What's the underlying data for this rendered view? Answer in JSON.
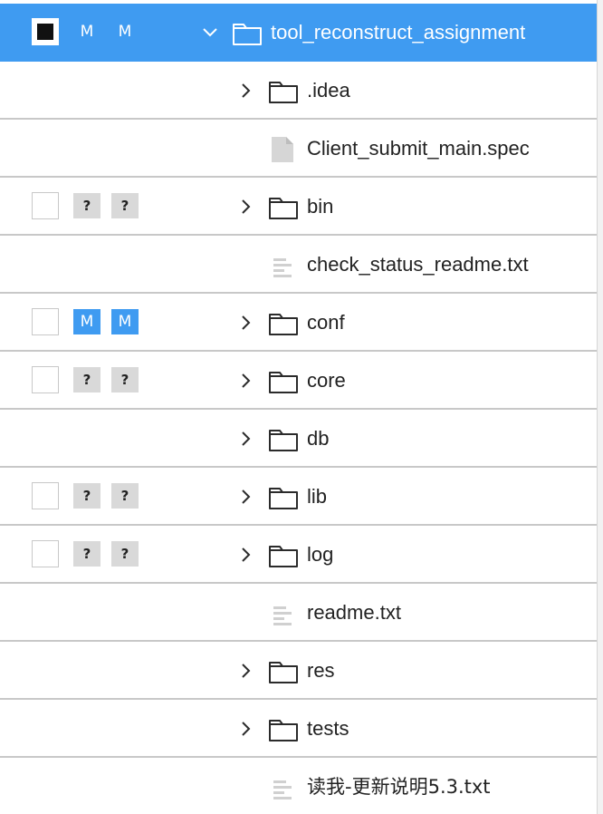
{
  "tree": {
    "items": [
      {
        "name": "tool_reconstruct_assignment",
        "type": "folder",
        "expanded": true,
        "selected": true,
        "checked": true,
        "status": [
          "M",
          "M"
        ]
      },
      {
        "name": ".idea",
        "type": "folder",
        "expanded": false,
        "selected": false,
        "checked": null,
        "status": []
      },
      {
        "name": "Client_submit_main.spec",
        "type": "file-generic",
        "selected": false,
        "checked": null,
        "status": []
      },
      {
        "name": "bin",
        "type": "folder",
        "expanded": false,
        "selected": false,
        "checked": false,
        "status": [
          "?",
          "?"
        ]
      },
      {
        "name": "check_status_readme.txt",
        "type": "file-text",
        "selected": false,
        "checked": null,
        "status": []
      },
      {
        "name": "conf",
        "type": "folder",
        "expanded": false,
        "selected": false,
        "checked": false,
        "status": [
          "M",
          "M"
        ]
      },
      {
        "name": "core",
        "type": "folder",
        "expanded": false,
        "selected": false,
        "checked": false,
        "status": [
          "?",
          "?"
        ]
      },
      {
        "name": "db",
        "type": "folder",
        "expanded": false,
        "selected": false,
        "checked": null,
        "status": []
      },
      {
        "name": "lib",
        "type": "folder",
        "expanded": false,
        "selected": false,
        "checked": false,
        "status": [
          "?",
          "?"
        ]
      },
      {
        "name": "log",
        "type": "folder",
        "expanded": false,
        "selected": false,
        "checked": false,
        "status": [
          "?",
          "?"
        ]
      },
      {
        "name": "readme.txt",
        "type": "file-text",
        "selected": false,
        "checked": null,
        "status": []
      },
      {
        "name": "res",
        "type": "folder",
        "expanded": false,
        "selected": false,
        "checked": null,
        "status": []
      },
      {
        "name": "tests",
        "type": "folder",
        "expanded": false,
        "selected": false,
        "checked": null,
        "status": []
      },
      {
        "name": "读我-更新说明5.3.txt",
        "type": "file-text",
        "selected": false,
        "checked": null,
        "status": []
      }
    ]
  },
  "colors": {
    "selection": "#3f9bf1",
    "modified_badge": "#3f9bf1",
    "unknown_badge": "#d9d9d9",
    "row_divider": "#c8c8c8",
    "icon_stroke": "#2b2b2b",
    "file_icon_fill": "#d6d6d6"
  }
}
